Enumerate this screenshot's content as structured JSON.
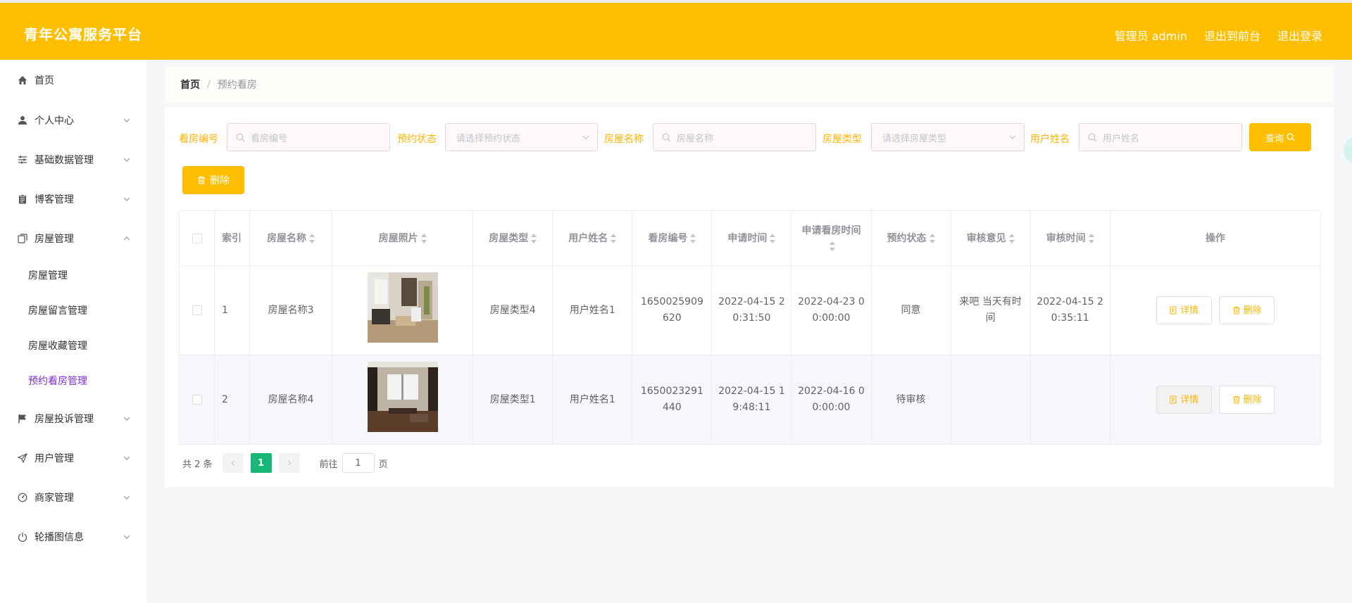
{
  "app": {
    "title": "青年公寓服务平台",
    "user_label": "管理员 admin",
    "front_link": "退出到前台",
    "logout": "退出登录"
  },
  "sidebar": {
    "items": [
      {
        "label": "首页",
        "icon": "home-icon"
      },
      {
        "label": "个人中心",
        "icon": "user-icon"
      },
      {
        "label": "基础数据管理",
        "icon": "sliders-icon"
      },
      {
        "label": "博客管理",
        "icon": "clipboard-icon"
      },
      {
        "label": "房屋管理",
        "icon": "copy-icon"
      },
      {
        "label": "房屋投诉管理",
        "icon": "flag-icon"
      },
      {
        "label": "用户管理",
        "icon": "send-icon"
      },
      {
        "label": "商家管理",
        "icon": "gauge-icon"
      },
      {
        "label": "轮播图信息",
        "icon": "power-icon"
      }
    ],
    "sub_items": [
      "房屋管理",
      "房屋留言管理",
      "房屋收藏管理",
      "预约看房管理"
    ]
  },
  "breadcrumb": {
    "home": "首页",
    "separator": "/",
    "current": "预约看房"
  },
  "filters": {
    "code_label": "看房编号",
    "code_placeholder": "看房编号",
    "status_label": "预约状态",
    "status_placeholder": "请选择预约状态",
    "name_label": "房屋名称",
    "name_placeholder": "房屋名称",
    "type_label": "房屋类型",
    "type_placeholder": "请选择房屋类型",
    "user_label": "用户姓名",
    "user_placeholder": "用户姓名",
    "query_button": "查询",
    "delete_button": "删除"
  },
  "table": {
    "headers": [
      "索引",
      "房屋名称",
      "房屋照片",
      "房屋类型",
      "用户姓名",
      "看房编号",
      "申请时间",
      "申请看房时间",
      "预约状态",
      "审核意见",
      "审核时间",
      "操作"
    ],
    "rows": [
      {
        "index": "1",
        "name": "房屋名称3",
        "type": "房屋类型4",
        "user": "用户姓名1",
        "code": "1650025909620",
        "apply_time": "2022-04-15 20:31:50",
        "view_time": "2022-04-23 00:00:00",
        "status": "同意",
        "opinion": "来吧 当天有时间",
        "review_time": "2022-04-15 20:35:11",
        "detail": "详情",
        "delete": "删除"
      },
      {
        "index": "2",
        "name": "房屋名称4",
        "type": "房屋类型1",
        "user": "用户姓名1",
        "code": "1650023291440",
        "apply_time": "2022-04-15 19:48:11",
        "view_time": "2022-04-16 00:00:00",
        "status": "待审核",
        "opinion": "",
        "review_time": "",
        "detail": "详情",
        "delete": "删除"
      }
    ]
  },
  "pagination": {
    "total": "共 2 条",
    "current": "1",
    "goto_label": "前往",
    "goto_value": "1",
    "page_unit": "页"
  },
  "colors": {
    "accent": "#ffbf00",
    "active_menu": "#7d2cd6",
    "pager_active": "#16b777"
  }
}
